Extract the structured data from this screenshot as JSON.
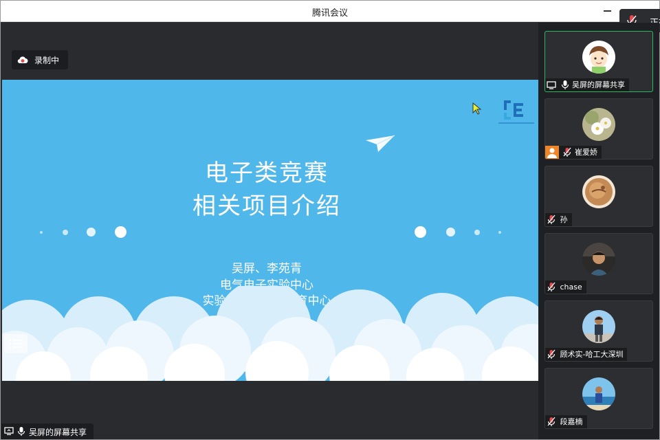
{
  "window": {
    "title": "腾讯会议"
  },
  "toast": {
    "text": "正在"
  },
  "recording": {
    "label": "录制中",
    "icon": "cloud-record-icon"
  },
  "slide": {
    "title_line1": "电子类竞赛",
    "title_line2": "相关项目介绍",
    "subtitle_line1": "吴屏、李苑青",
    "subtitle_line2": "电气电子实验中心",
    "subtitle_line3": "实验与创新实践教育中心",
    "background_color": "#4fb7ea"
  },
  "share_label": {
    "text": "吴屏的屏幕共享"
  },
  "participants": [
    {
      "name": "吴屏的屏幕共享",
      "mic": "on",
      "sharing": true,
      "active": true
    },
    {
      "name": "崔爱娇",
      "mic": "muted",
      "sharing": false,
      "active": false
    },
    {
      "name": "孙",
      "mic": "muted",
      "sharing": false,
      "active": false
    },
    {
      "name": "chase",
      "mic": "muted",
      "sharing": false,
      "active": false
    },
    {
      "name": "顾术实-哈工大深圳",
      "mic": "muted",
      "sharing": false,
      "active": false
    },
    {
      "name": "段嘉楠",
      "mic": "muted",
      "sharing": false,
      "active": false
    }
  ],
  "colors": {
    "accent_active": "#2fb665",
    "muted_red": "#e5484d",
    "panel": "#2d2e31"
  }
}
